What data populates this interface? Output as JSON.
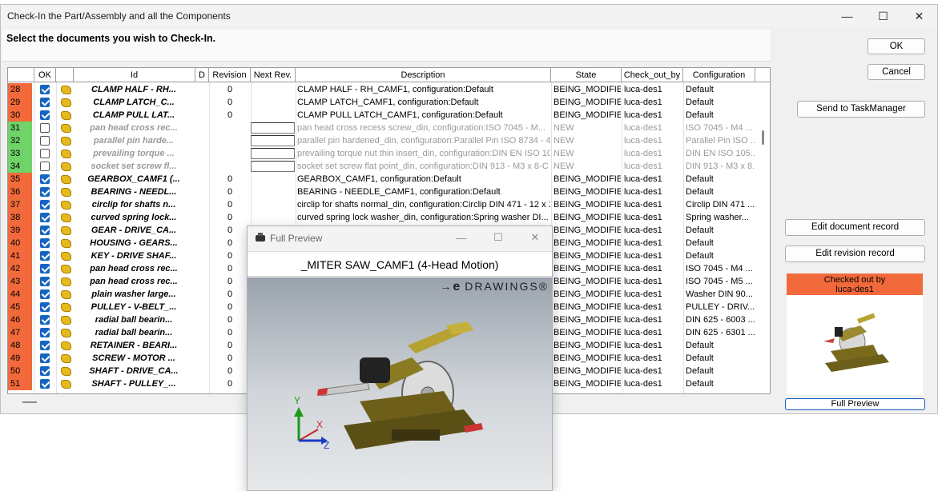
{
  "window": {
    "title": "Check-In the Part/Assembly and all the Components"
  },
  "prompt": "Select the documents you wish to Check-In.",
  "columns": {
    "ok": "OK",
    "id": "Id",
    "d": "D",
    "revision": "Revision",
    "next_rev": "Next Rev.",
    "description": "Description",
    "state": "State",
    "checkout": "Check_out_by",
    "configuration": "Configuration"
  },
  "rows": [
    {
      "n": "28",
      "color": "red",
      "checked": true,
      "id": "CLAMP HALF - RH...",
      "rev": "0",
      "desc": "CLAMP HALF - RH_CAMF1, configuration:Default",
      "state": "BEING_MODIFIED",
      "cob": "luca-des1",
      "conf": "Default"
    },
    {
      "n": "29",
      "color": "red",
      "checked": true,
      "id": "CLAMP LATCH_C...",
      "rev": "0",
      "desc": "CLAMP LATCH_CAMF1, configuration:Default",
      "state": "BEING_MODIFIED",
      "cob": "luca-des1",
      "conf": "Default"
    },
    {
      "n": "30",
      "color": "red",
      "checked": true,
      "id": "CLAMP PULL LAT...",
      "rev": "0",
      "desc": "CLAMP PULL LATCH_CAMF1, configuration:Default",
      "state": "BEING_MODIFIED",
      "cob": "luca-des1",
      "conf": "Default"
    },
    {
      "n": "31",
      "color": "green",
      "checked": false,
      "grey": true,
      "id": "pan head cross rec...",
      "rev": "",
      "desc": "pan head cross recess screw_din, configuration:ISO 7045 - M...",
      "state": "NEW",
      "cob": "luca-des1",
      "conf": "ISO 7045 - M4 ..."
    },
    {
      "n": "32",
      "color": "green",
      "checked": false,
      "grey": true,
      "id": "parallel pin harde...",
      "rev": "",
      "desc": "parallel pin hardened_din, configuration:Parallel Pin ISO 8734 - 4...",
      "state": "NEW",
      "cob": "luca-des1",
      "conf": "Parallel Pin ISO ..."
    },
    {
      "n": "33",
      "color": "green",
      "checked": false,
      "grey": true,
      "id": "prevailing torque ...",
      "rev": "",
      "desc": "prevailing torque nut thin insert_din, configuration:DIN EN ISO 10...",
      "state": "NEW",
      "cob": "luca-des1",
      "conf": "DIN EN ISO 105..."
    },
    {
      "n": "34",
      "color": "green",
      "checked": false,
      "grey": true,
      "id": "socket set screw fl...",
      "rev": "",
      "desc": "socket set screw flat point_din, configuration:DIN 913 - M3 x 8-C",
      "state": "NEW",
      "cob": "luca-des1",
      "conf": "DIN 913 - M3 x 8..."
    },
    {
      "n": "35",
      "color": "red",
      "checked": true,
      "id": "GEARBOX_CAMF1 (...",
      "rev": "0",
      "desc": "GEARBOX_CAMF1, configuration:Default",
      "state": "BEING_MODIFIED",
      "cob": "luca-des1",
      "conf": "Default"
    },
    {
      "n": "36",
      "color": "red",
      "checked": true,
      "id": "BEARING - NEEDL...",
      "rev": "0",
      "desc": "BEARING - NEEDLE_CAMF1, configuration:Default",
      "state": "BEING_MODIFIED",
      "cob": "luca-des1",
      "conf": "Default"
    },
    {
      "n": "37",
      "color": "red",
      "checked": true,
      "id": "circlip for shafts n...",
      "rev": "0",
      "desc": "circlip for shafts normal_din, configuration:Circlip DIN 471 - 12 x 1",
      "state": "BEING_MODIFIED",
      "cob": "luca-des1",
      "conf": "Circlip DIN 471 ..."
    },
    {
      "n": "38",
      "color": "red",
      "checked": true,
      "id": "curved spring lock...",
      "rev": "0",
      "desc": "curved spring lock washer_din, configuration:Spring washer DI...",
      "state": "BEING_MODIFIED",
      "cob": "luca-des1",
      "conf": "Spring washer..."
    },
    {
      "n": "39",
      "color": "red",
      "checked": true,
      "id": "GEAR - DRIVE_CA...",
      "rev": "0",
      "desc": "",
      "state": "BEING_MODIFIED",
      "cob": "luca-des1",
      "conf": "Default"
    },
    {
      "n": "40",
      "color": "red",
      "checked": true,
      "id": "HOUSING - GEARS...",
      "rev": "0",
      "desc": "",
      "state": "BEING_MODIFIED",
      "cob": "luca-des1",
      "conf": "Default"
    },
    {
      "n": "41",
      "color": "red",
      "checked": true,
      "id": "KEY - DRIVE SHAF...",
      "rev": "0",
      "desc": "",
      "state": "BEING_MODIFIED",
      "cob": "luca-des1",
      "conf": "Default"
    },
    {
      "n": "42",
      "color": "red",
      "checked": true,
      "id": "pan head cross rec...",
      "rev": "0",
      "desc": "",
      "state": "BEING_MODIFIED",
      "cob": "luca-des1",
      "conf": "ISO 7045 - M4 ..."
    },
    {
      "n": "43",
      "color": "red",
      "checked": true,
      "id": "pan head cross rec...",
      "rev": "0",
      "desc": "",
      "state": "BEING_MODIFIED",
      "cob": "luca-des1",
      "conf": "ISO 7045 - M5 ..."
    },
    {
      "n": "44",
      "color": "red",
      "checked": true,
      "id": "plain washer large...",
      "rev": "0",
      "desc": "",
      "state": "BEING_MODIFIED",
      "cob": "luca-des1",
      "conf": "Washer DIN 90..."
    },
    {
      "n": "45",
      "color": "red",
      "checked": true,
      "id": "PULLEY - V-BELT_...",
      "rev": "0",
      "desc": "",
      "state": "BEING_MODIFIED",
      "cob": "luca-des1",
      "conf": "PULLEY - DRIV..."
    },
    {
      "n": "46",
      "color": "red",
      "checked": true,
      "id": "radial ball bearin...",
      "rev": "0",
      "desc": "",
      "state": "BEING_MODIFIED",
      "cob": "luca-des1",
      "conf": "DIN 625 - 6003 ..."
    },
    {
      "n": "47",
      "color": "red",
      "checked": true,
      "id": "radial ball bearin...",
      "rev": "0",
      "desc": "",
      "state": "BEING_MODIFIED",
      "cob": "luca-des1",
      "conf": "DIN 625 - 6301 ..."
    },
    {
      "n": "48",
      "color": "red",
      "checked": true,
      "id": "RETAINER - BEARI...",
      "rev": "0",
      "desc": "",
      "state": "BEING_MODIFIED",
      "cob": "luca-des1",
      "conf": "Default"
    },
    {
      "n": "49",
      "color": "red",
      "checked": true,
      "id": "SCREW - MOTOR ...",
      "rev": "0",
      "desc": "",
      "state": "BEING_MODIFIED",
      "cob": "luca-des1",
      "conf": "Default"
    },
    {
      "n": "50",
      "color": "red",
      "checked": true,
      "id": "SHAFT - DRIVE_CA...",
      "rev": "0",
      "desc": "",
      "state": "BEING_MODIFIED",
      "cob": "luca-des1",
      "conf": "Default"
    },
    {
      "n": "51",
      "color": "red",
      "checked": true,
      "id": "SHAFT - PULLEY_...",
      "rev": "0",
      "desc": "",
      "state": "BEING_MODIFIED",
      "cob": "luca-des1",
      "conf": "Default"
    }
  ],
  "buttons": {
    "ok": "OK",
    "cancel": "Cancel",
    "send": "Send to TaskManager",
    "edit_doc": "Edit document record",
    "edit_rev": "Edit revision record",
    "full_preview": "Full Preview"
  },
  "checked_out": {
    "line1": "Checked out by",
    "line2": "luca-des1"
  },
  "preview": {
    "title": "Full Preview",
    "doc_name": "_MITER SAW_CAMF1 (4-Head Motion)",
    "brand_e": "e",
    "brand_rest": "DRAWINGS®",
    "axis_x": "X",
    "axis_y": "Y",
    "axis_z": "Z"
  },
  "colors": {
    "red": "#f26a3b",
    "green": "#6fd36a",
    "accent": "#1565c0"
  }
}
